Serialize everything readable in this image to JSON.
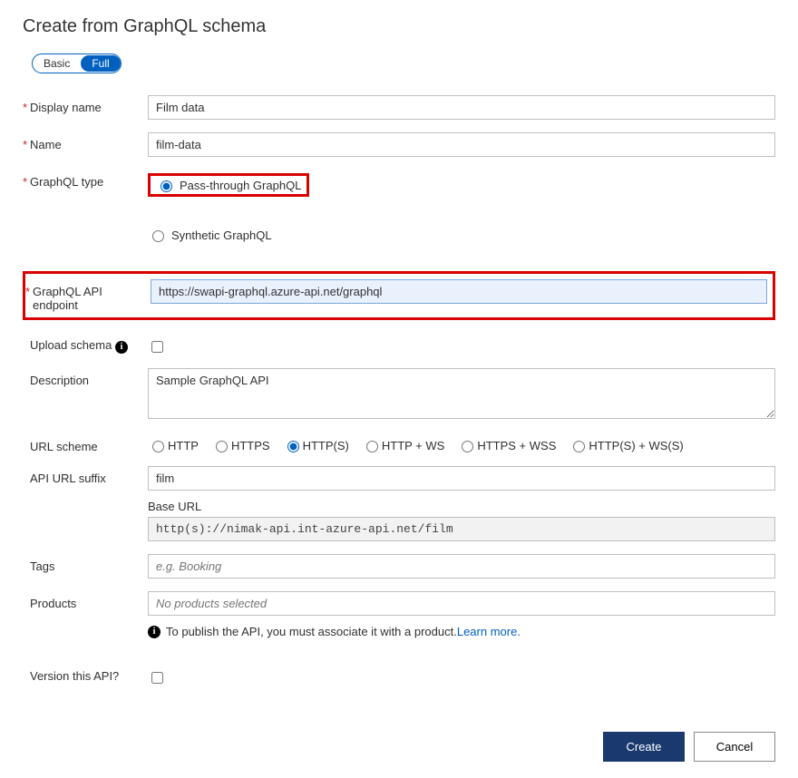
{
  "title": "Create from GraphQL schema",
  "toggle": {
    "basic": "Basic",
    "full": "Full"
  },
  "fields": {
    "display_name": {
      "label": "Display name",
      "value": "Film data"
    },
    "name": {
      "label": "Name",
      "value": "film-data"
    },
    "graphql_type": {
      "label": "GraphQL type",
      "passthrough": "Pass-through GraphQL",
      "synthetic": "Synthetic GraphQL"
    },
    "endpoint": {
      "label": "GraphQL API endpoint",
      "value": "https://swapi-graphql.azure-api.net/graphql"
    },
    "upload_schema": {
      "label": "Upload schema"
    },
    "description": {
      "label": "Description",
      "value": "Sample GraphQL API"
    },
    "url_scheme": {
      "label": "URL scheme",
      "opts": {
        "http": "HTTP",
        "https": "HTTPS",
        "http_s": "HTTP(S)",
        "http_ws": "HTTP + WS",
        "https_wss": "HTTPS + WSS",
        "http_s_ws_s": "HTTP(S) + WS(S)"
      }
    },
    "suffix": {
      "label": "API URL suffix",
      "value": "film"
    },
    "base_url": {
      "label": "Base URL",
      "value": "http(s)://nimak-api.int-azure-api.net/film"
    },
    "tags": {
      "label": "Tags",
      "placeholder": "e.g. Booking"
    },
    "products": {
      "label": "Products",
      "placeholder": "No products selected"
    },
    "publish_note": {
      "text": "To publish the API, you must associate it with a product. ",
      "link": "Learn more"
    },
    "version": {
      "label": "Version this API?"
    }
  },
  "footer": {
    "create": "Create",
    "cancel": "Cancel"
  }
}
